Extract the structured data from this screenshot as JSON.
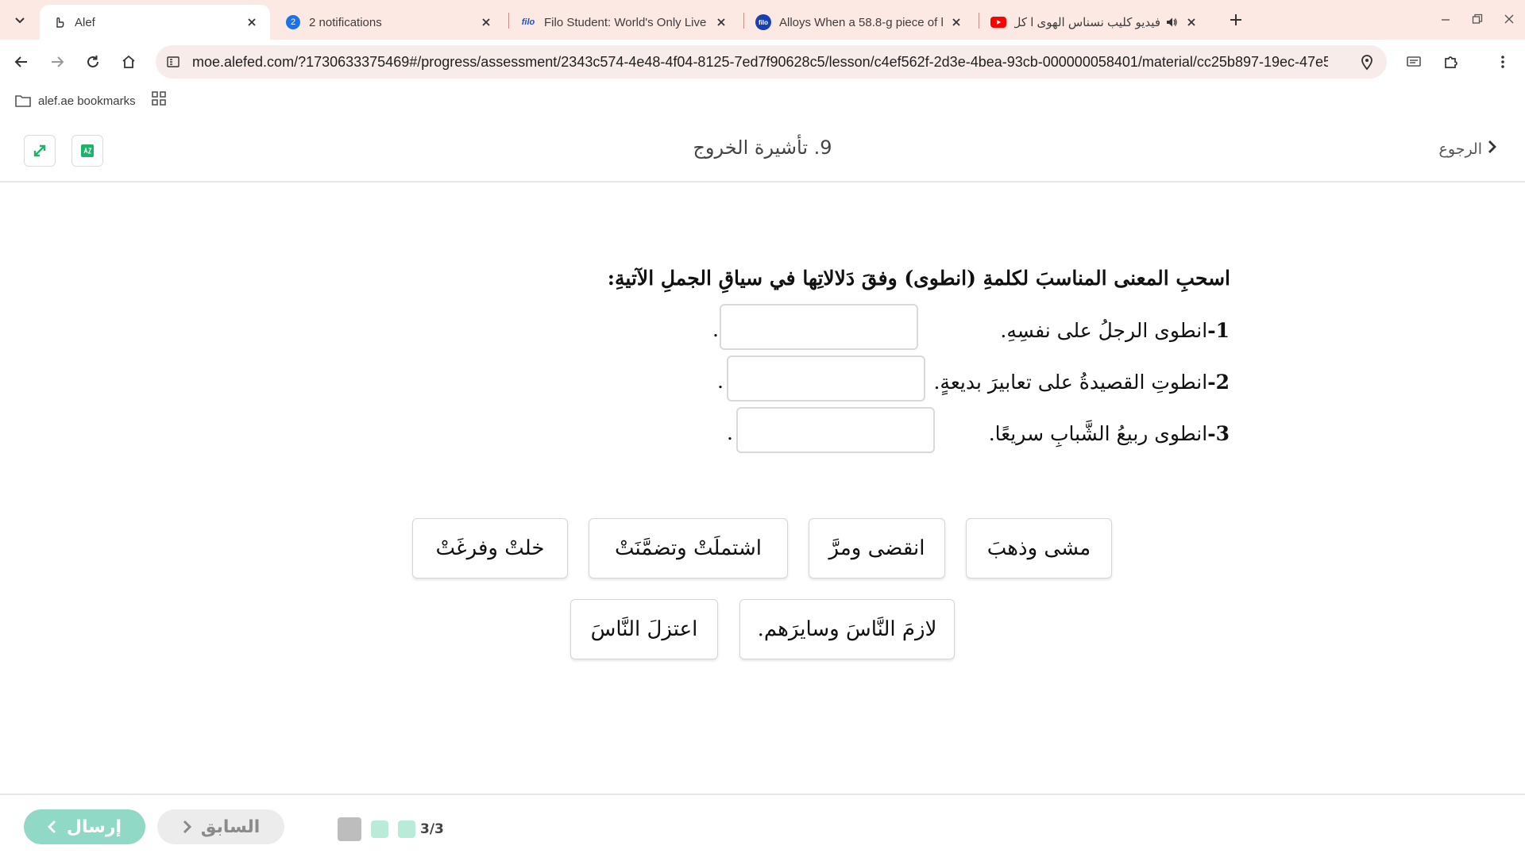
{
  "browser": {
    "tabs": [
      {
        "title": "Alef",
        "active": true
      },
      {
        "title": "2 notifications",
        "badge": "2",
        "active": false
      },
      {
        "title": "Filo Student: World's Only Live I",
        "favicon_text": "filo",
        "active": false
      },
      {
        "title": "Alloys When a 58.8-g piece of h",
        "favicon_text": "filo",
        "active": false
      },
      {
        "title": "فيديو كليب نسناس الهوى ا كل",
        "active": false
      }
    ],
    "url": "moe.alefed.com/?1730633375469#/progress/assessment/2343c574-4e48-4f04-8125-7ed7f90628c5/lesson/c4ef562f-2d3e-4bea-93cb-000000058401/material/cc25b897-19ec-47e5-...",
    "bookmark_label": "alef.ae bookmarks"
  },
  "header": {
    "title": "9. تأشيرة الخروج",
    "back_label": "الرجوع"
  },
  "question": {
    "prompt": "اسحبِ المعنى المناسبَ لكلمةِ (انطوى) وفقَ دَلالاتِها في سياقِ الجملِ الآتيةِ:",
    "sentences": [
      {
        "num": "1-",
        "text": "انطوى الرجلُ على نفسِهِ."
      },
      {
        "num": "2-",
        "text": "انطوتِ القصيدةُ على تعابيرَ بديعةٍ."
      },
      {
        "num": "3-",
        "text": "انطوى ربيعُ الشَّبابِ سريعًا."
      }
    ],
    "trailing_dot": ".",
    "options": [
      "مشى وذهبَ",
      "انقضى ومرَّ",
      "اشتملَتْ وتضمَّنَتْ",
      "خلتْ وفرغَتْ",
      "لازمَ النَّاسَ وسايرَهم.",
      "اعتزلَ النَّاسَ"
    ]
  },
  "footer": {
    "send_label": "إرسال",
    "prev_label": "السابق",
    "progress_text": "3/3"
  },
  "colors": {
    "tabstrip": "#fde9e4",
    "accent_green": "#8fd9c6",
    "progress_done": "#b8ecd9",
    "progress_current": "#bdbdbd",
    "icon_green": "#20b26b"
  }
}
